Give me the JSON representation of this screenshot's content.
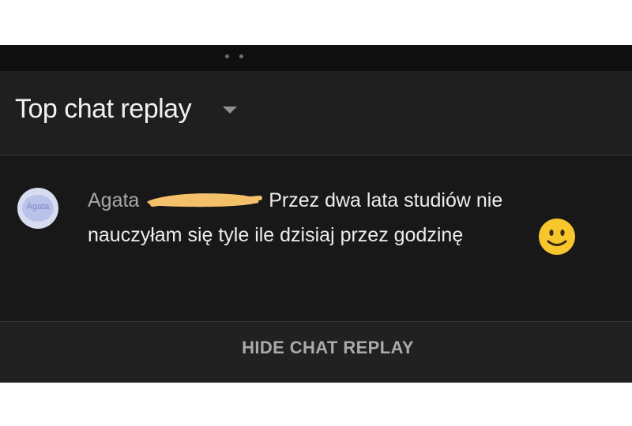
{
  "header": {
    "title": "Top chat replay"
  },
  "message": {
    "avatar_text": "Agata",
    "author": "Agata",
    "text_line1": "Przez dwa lata studiów nie",
    "text_line2": "nauczyłam się tyle ile dzisiaj przez godzinę",
    "emoji_icon": "slightly-smiling-face-icon",
    "redaction_color": "#f5c06a"
  },
  "footer": {
    "hide_label": "HIDE CHAT REPLAY"
  },
  "colors": {
    "background": "#181818",
    "header_background": "#1f1f1f",
    "text": "#ededed",
    "author": "#a8a8a8"
  }
}
